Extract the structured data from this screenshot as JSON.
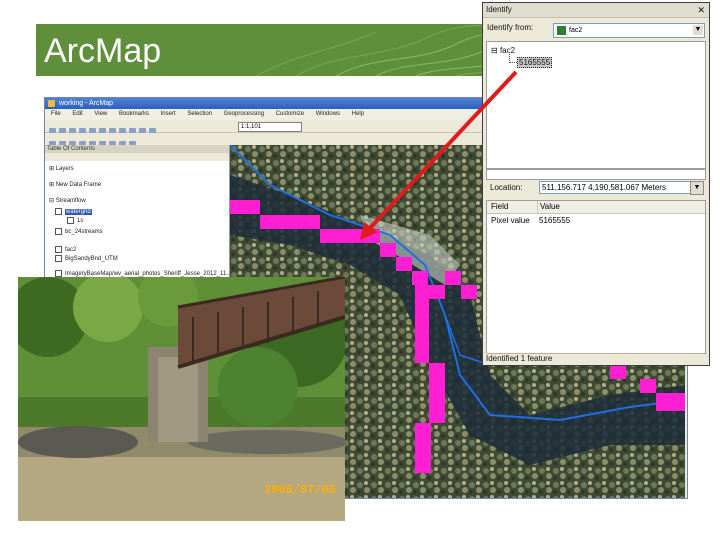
{
  "slide": {
    "title": "ArcMap"
  },
  "arcmap": {
    "window_title": "working - ArcMap",
    "menu": [
      "File",
      "Edit",
      "View",
      "Bookmarks",
      "Insert",
      "Selection",
      "Geoprocessing",
      "Customize",
      "Windows",
      "Help"
    ],
    "scale": "1:1,101",
    "toc": {
      "header": "Table Of Contents",
      "items": [
        "Layers",
        "New Data Frame",
        "Streamflow",
        "watergrid",
        "1s",
        "bc_24streams",
        "fac2",
        "BigSandyBnd_UTM",
        "ImageryBaseMap/wv_aerial_photos_Sheriff_Jesse_2012_11..."
      ]
    }
  },
  "photo": {
    "date_stamp": "2005/07/05"
  },
  "identify": {
    "title": "Identify",
    "identify_from_label": "Identify from:",
    "identify_from_value": "fac2",
    "tree_root": "fac2",
    "tree_child": "5165555",
    "location_label": "Location:",
    "location_value": "511,156.717  4,190,581.067 Meters",
    "columns": [
      "Field",
      "Value"
    ],
    "rows": [
      {
        "field": "Pixel value",
        "value": "5165555"
      }
    ],
    "status": "Identified 1 feature"
  },
  "colors": {
    "banner": "#5f8f3a",
    "stream_cells": "#ff1fd2",
    "stream_line": "#1e6fe0",
    "arrow": "#e11b1b"
  }
}
